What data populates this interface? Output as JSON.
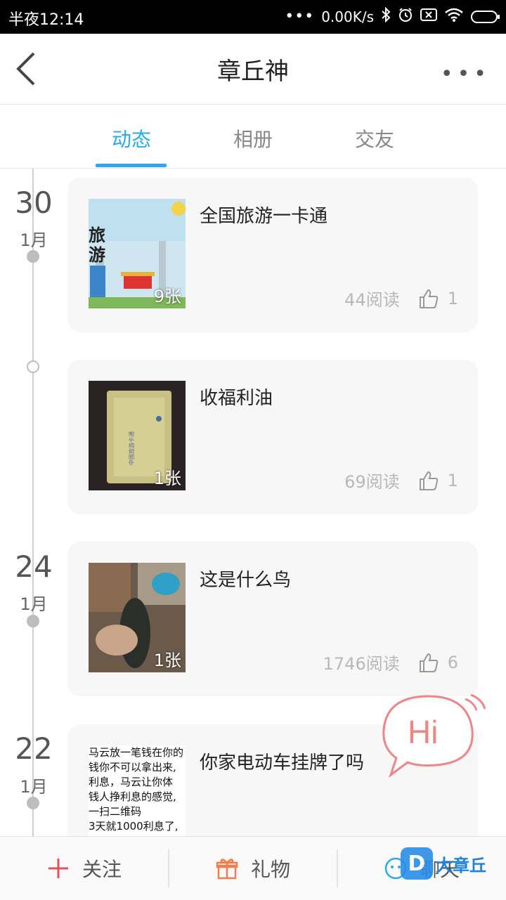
{
  "status_bar": {
    "time": "半夜12:14",
    "dots": "•••",
    "speed": "0.00K/s",
    "icons": [
      "bluetooth-icon",
      "alarm-icon",
      "sim-off-icon",
      "wifi-icon",
      "battery-icon"
    ]
  },
  "header": {
    "title": "章丘神",
    "more": "•••"
  },
  "tabs": [
    {
      "label": "动态",
      "active": true
    },
    {
      "label": "相册",
      "active": false
    },
    {
      "label": "交友",
      "active": false
    }
  ],
  "posts": [
    {
      "day": "30",
      "month": "1月",
      "title": "全国旅游一卡通",
      "photos": "9张",
      "reads": "44阅读",
      "likes": "1",
      "thumb_text": "旅\n游"
    },
    {
      "title": "收福利油",
      "photos": "1张",
      "reads": "69阅读",
      "likes": "1"
    },
    {
      "day": "24",
      "month": "1月",
      "title": "这是什么鸟",
      "photos": "1张",
      "reads": "1746阅读",
      "likes": "6"
    },
    {
      "day": "22",
      "month": "1月",
      "title": "你家电动车挂牌了吗",
      "photos": "",
      "thumb_lines": [
        "马云放一笔钱在你的",
        "钱你不可以拿出来,",
        "利息，马云让你体",
        "钱人挣利息的感觉,",
        "一扫二维码",
        "3天就1000利息了,"
      ]
    }
  ],
  "hi_bubble": {
    "text": "Hi"
  },
  "bottom_bar": {
    "follow": "关注",
    "gift": "礼物",
    "chat": "聊天"
  },
  "watermark": {
    "letter": "D",
    "text": "大章丘"
  },
  "colors": {
    "accent": "#29aaf0",
    "hi": "#f08585",
    "follow": "#e8505b",
    "gift": "#f07d4a"
  }
}
